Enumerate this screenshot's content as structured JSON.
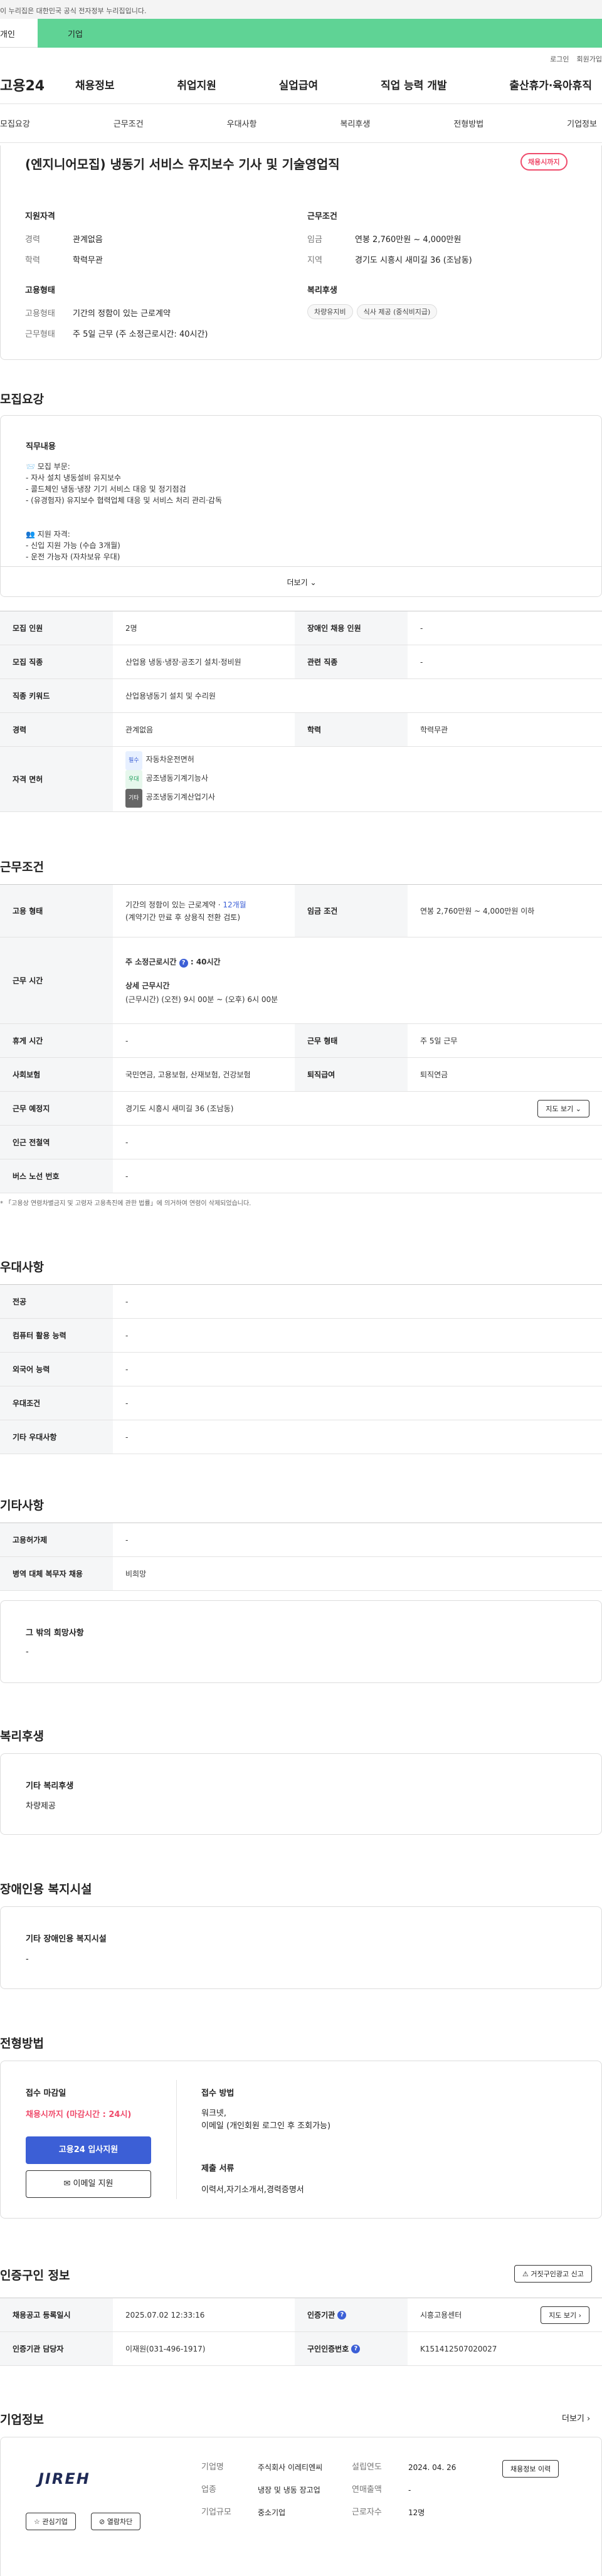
{
  "gov_banner": "이 누리집은 대한민국 공식 전자정부 누리집입니다.",
  "tabs": {
    "individual": "개인",
    "company": "기업"
  },
  "util": [
    "로그인",
    "회원가입"
  ],
  "logo": "고용24",
  "gnb": [
    "채용정보",
    "취업지원",
    "실업급여",
    "직업 능력 개발",
    "출산휴가·육아휴직"
  ],
  "subnav": [
    "모집요강",
    "근무조건",
    "우대사항",
    "복리후생",
    "전형방법",
    "기업정보"
  ],
  "job": {
    "title": "(엔지니어모집) 냉동기 서비스 유지보수 기사 및 기술영업직",
    "badge": "채용시까지",
    "qual_title": "지원자격",
    "cond_title": "근무조건",
    "career_label": "경력",
    "career": "관계없음",
    "edu_label": "학력",
    "edu": "학력무관",
    "wage_label": "임금",
    "wage": "연봉 2,760만원 ~ 4,000만원",
    "loc_label": "지역",
    "loc": "경기도 시흥시 새미길 36 (조남동)",
    "emp_title": "고용형태",
    "welfare_title": "복리후생",
    "emptype_label": "고용형태",
    "emptype": "기간의 정함이 있는 근로계약",
    "worktype_label": "근무형태",
    "worktype": "주 5일 근무 (주 소정근로시간: 40시간)",
    "welfare_chips": [
      "차량유지비",
      "식사 제공 (중식비지급)"
    ]
  },
  "recruit": {
    "title": "모집요강",
    "duty_title": "직무내용",
    "duty_lines": [
      "📨 모집 부문:",
      "- 자사 설치 냉동설비 유지보수",
      "- 콜드체인 냉동·냉장 기기 서비스 대응 및 정기점검",
      "- (유경험자) 유지보수 협력업체 대응 및 서비스 처리 관리·감독",
      "👥 지원 자격:",
      "- 신입 지원 가능 (수습 3개월)",
      "- 운전 가능자 (자차보유 우대)"
    ],
    "more": "더보기"
  },
  "recruit_table": {
    "r1": [
      "모집 인원",
      "2명",
      "장애인 채용 인원",
      "-"
    ],
    "r2": [
      "모집 직종",
      "산업용 냉동·냉장·공조기 설치·정비원",
      "관련 직종",
      "-"
    ],
    "r3": [
      "직종 키워드",
      "산업용냉동기 설치 및 수리원"
    ],
    "r4": [
      "경력",
      "관계없음",
      "학력",
      "학력무관"
    ],
    "license_label": "자격 면허",
    "licenses": [
      {
        "tag": "필수",
        "name": "자동차운전면허"
      },
      {
        "tag": "우대",
        "name": "공조냉동기계기능사"
      },
      {
        "tag": "기타",
        "name": "공조냉동기계산업기사"
      }
    ]
  },
  "work": {
    "title": "근무조건",
    "emp_label": "고용 형태",
    "emp_line1": "기간의 정함이 있는 근로계약 · ",
    "emp_hl": "12개월",
    "emp_line2": "(계약기간 만료 후 상용직 전환 검토)",
    "wage_label": "임금 조건",
    "wage": "연봉 2,760만원 ~ 4,000만원 이하",
    "time_label": "근무 시간",
    "week_hours_label": "주 소정근로시간",
    "week_hours": "40시간",
    "detail_label": "상세 근무시간",
    "detail": "(근무시간) (오전) 9시 00분 ~ (오후) 6시 00분",
    "rest_label": "휴게 시간",
    "rest": "-",
    "form_label": "근무 형태",
    "form": "주 5일 근무",
    "ins_label": "사회보험",
    "ins": "국민연금, 고용보험, 산재보험, 건강보험",
    "retire_label": "퇴직급여",
    "retire": "퇴직연금",
    "place_label": "근무 예정지",
    "place": "경기도 시흥시 새미길 36 (조남동)",
    "map_btn": "지도 보기",
    "subway_label": "인근 전철역",
    "subway": "-",
    "bus_label": "버스 노선 번호",
    "bus": "-",
    "note": "* 「고용상 연령차별금지 및 고령자 고용촉진에 관한 법률」에 의거하여 연령이 삭제되었습니다."
  },
  "pref": {
    "title": "우대사항",
    "rows": [
      [
        "전공",
        "-"
      ],
      [
        "컴퓨터 활용 능력",
        "-"
      ],
      [
        "외국어 능력",
        "-"
      ],
      [
        "우대조건",
        "-"
      ],
      [
        "기타 우대사항",
        "-"
      ]
    ]
  },
  "etc": {
    "title": "기타사항",
    "rows": [
      [
        "고용허가제",
        "-"
      ],
      [
        "병역 대체 복무자 채용",
        "비희망"
      ]
    ],
    "wish_title": "그 밖의 희망사항",
    "wish": "-"
  },
  "welfare": {
    "title": "복리후생",
    "sub": "기타 복리후생",
    "val": "차량제공"
  },
  "disabled": {
    "title": "장애인용 복지시설",
    "sub": "기타 장애인용 복지시설",
    "val": "-"
  },
  "process": {
    "title": "전형방법",
    "deadline_label": "접수 마감일",
    "deadline": "채용시까지 (마감시간 : 24시)",
    "apply_btn": "고용24 입사지원",
    "email_btn": "이메일 지원",
    "method_label": "접수 방법",
    "method": "워크넷,",
    "method2": "이메일 (개인회원 로그인 후 조회가능)",
    "docs_label": "제출 서류",
    "docs": "이력서,자기소개서,경력증명서"
  },
  "agency": {
    "title": "인증구인 정보",
    "report_btn": "거짓구인광고 신고",
    "reg_label": "채용공고 등록일시",
    "reg": "2025.07.02 12:33:16",
    "agency_label": "인증기관",
    "agency": "시흥고용센터",
    "map_btn": "지도 보기",
    "mgr_label": "인증기관 담당자",
    "mgr": "이재원(031-496-1917)",
    "no_label": "구인인증번호",
    "no": "K151412507020027"
  },
  "company": {
    "title": "기업정보",
    "more": "더보기",
    "logo_text": "JIREH",
    "fav_btn": "관심기업",
    "block_btn": "열람차단",
    "name_label": "기업명",
    "name": "주식회사 이레티엔씨",
    "biz_label": "업종",
    "biz": "냉장 및 냉동 장고업",
    "size_label": "기업규모",
    "size": "중소기업",
    "est_label": "설립연도",
    "est": "2024. 04. 26",
    "sales_label": "연매출액",
    "sales": "-",
    "emp_label": "근로자수",
    "emp": "12명",
    "info_btn": "채용정보 이력"
  },
  "colors": {
    "green": "#5fd395",
    "red": "#ef4b6b",
    "blue": "#3c5fd6"
  }
}
